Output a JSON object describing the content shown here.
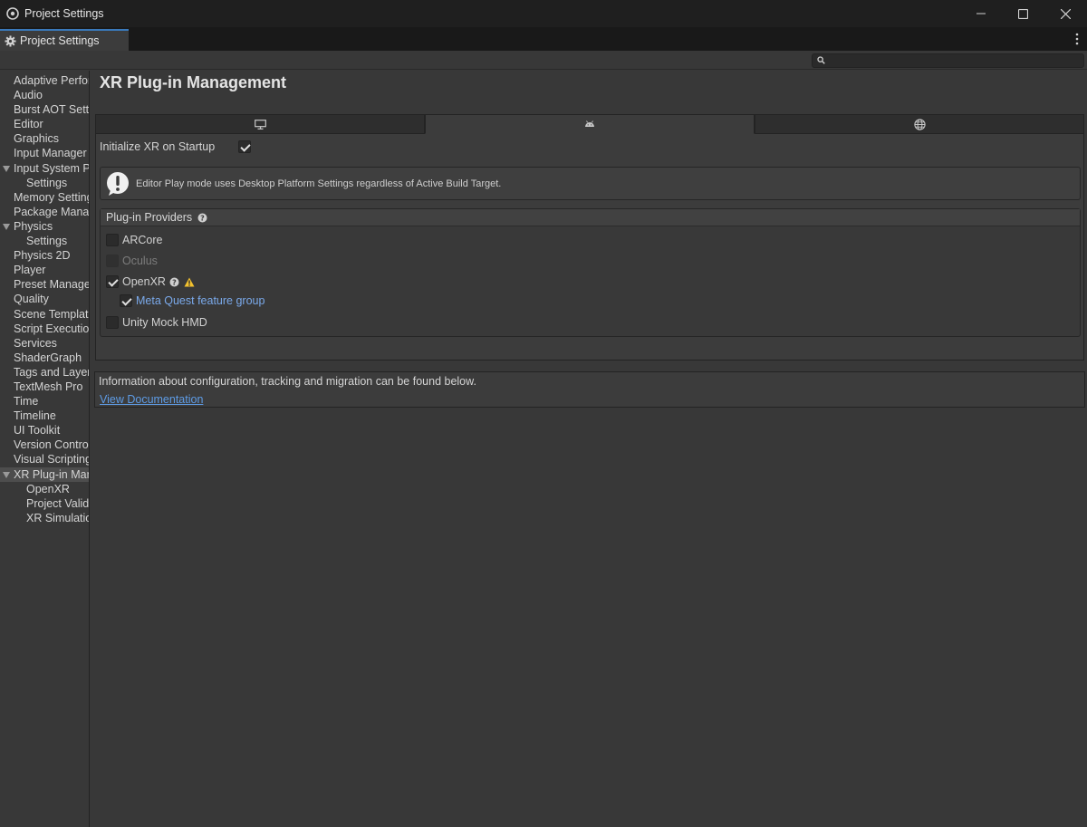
{
  "window": {
    "title": "Project Settings",
    "controls": [
      "minimize-icon",
      "maximize-icon",
      "close-icon"
    ]
  },
  "tab": {
    "label": "Project Settings"
  },
  "search": {
    "placeholder": ""
  },
  "sidebar": {
    "items": [
      {
        "label": "Adaptive Performance",
        "level": 0,
        "expanded": null,
        "selected": false
      },
      {
        "label": "Audio",
        "level": 0,
        "expanded": null,
        "selected": false
      },
      {
        "label": "Burst AOT Settings",
        "level": 0,
        "expanded": null,
        "selected": false
      },
      {
        "label": "Editor",
        "level": 0,
        "expanded": null,
        "selected": false
      },
      {
        "label": "Graphics",
        "level": 0,
        "expanded": null,
        "selected": false
      },
      {
        "label": "Input Manager",
        "level": 0,
        "expanded": null,
        "selected": false
      },
      {
        "label": "Input System Package",
        "level": 0,
        "expanded": true,
        "selected": false
      },
      {
        "label": "Settings",
        "level": 1,
        "expanded": null,
        "selected": false
      },
      {
        "label": "Memory Settings",
        "level": 0,
        "expanded": null,
        "selected": false
      },
      {
        "label": "Package Manager",
        "level": 0,
        "expanded": null,
        "selected": false
      },
      {
        "label": "Physics",
        "level": 0,
        "expanded": true,
        "selected": false
      },
      {
        "label": "Settings",
        "level": 1,
        "expanded": null,
        "selected": false
      },
      {
        "label": "Physics 2D",
        "level": 0,
        "expanded": null,
        "selected": false
      },
      {
        "label": "Player",
        "level": 0,
        "expanded": null,
        "selected": false
      },
      {
        "label": "Preset Manager",
        "level": 0,
        "expanded": null,
        "selected": false
      },
      {
        "label": "Quality",
        "level": 0,
        "expanded": null,
        "selected": false
      },
      {
        "label": "Scene Template",
        "level": 0,
        "expanded": null,
        "selected": false
      },
      {
        "label": "Script Execution Order",
        "level": 0,
        "expanded": null,
        "selected": false
      },
      {
        "label": "Services",
        "level": 0,
        "expanded": null,
        "selected": false
      },
      {
        "label": "ShaderGraph",
        "level": 0,
        "expanded": null,
        "selected": false
      },
      {
        "label": "Tags and Layers",
        "level": 0,
        "expanded": null,
        "selected": false
      },
      {
        "label": "TextMesh Pro",
        "level": 0,
        "expanded": null,
        "selected": false
      },
      {
        "label": "Time",
        "level": 0,
        "expanded": null,
        "selected": false
      },
      {
        "label": "Timeline",
        "level": 0,
        "expanded": null,
        "selected": false
      },
      {
        "label": "UI Toolkit",
        "level": 0,
        "expanded": null,
        "selected": false
      },
      {
        "label": "Version Control",
        "level": 0,
        "expanded": null,
        "selected": false
      },
      {
        "label": "Visual Scripting",
        "level": 0,
        "expanded": null,
        "selected": false
      },
      {
        "label": "XR Plug-in Management",
        "level": 0,
        "expanded": true,
        "selected": true
      },
      {
        "label": "OpenXR",
        "level": 1,
        "expanded": null,
        "selected": false
      },
      {
        "label": "Project Validation",
        "level": 1,
        "expanded": null,
        "selected": false
      },
      {
        "label": "XR Simulation",
        "level": 1,
        "expanded": null,
        "selected": false
      }
    ]
  },
  "main": {
    "title": "XR Plug-in Management",
    "platform_tabs": [
      {
        "icon": "desktop-monitor-icon",
        "active": false
      },
      {
        "icon": "android-icon",
        "active": true
      },
      {
        "icon": "web-globe-icon",
        "active": false
      }
    ],
    "init_xr": {
      "label": "Initialize XR on Startup",
      "checked": true
    },
    "help_message": "Editor Play mode uses Desktop Platform Settings regardless of Active Build Target.",
    "providers": {
      "header": "Plug-in Providers",
      "items": [
        {
          "label": "ARCore",
          "checked": false,
          "disabled": false
        },
        {
          "label": "Oculus",
          "checked": false,
          "disabled": true
        },
        {
          "label": "OpenXR",
          "checked": true,
          "disabled": false,
          "has_help": true,
          "has_warning": true
        },
        {
          "label": "Meta Quest feature group",
          "checked": true,
          "disabled": false,
          "sub": true
        },
        {
          "label": "Unity Mock HMD",
          "checked": false,
          "disabled": false
        }
      ]
    },
    "info": {
      "text": "Information about configuration, tracking and migration can be found below.",
      "link": "View Documentation"
    }
  },
  "colors": {
    "accent_tab": "#3a79bb",
    "link": "#5e9ce6",
    "sub_item": "#7aa9ea",
    "warning": "#f2c12e"
  }
}
